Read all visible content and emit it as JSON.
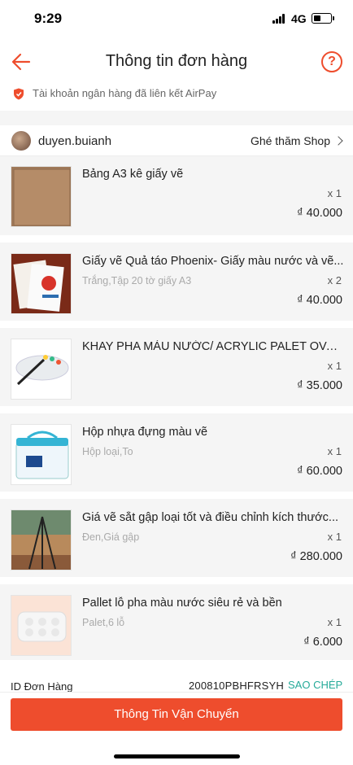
{
  "status": {
    "time": "9:29",
    "network": "4G"
  },
  "header": {
    "title": "Thông tin đơn hàng",
    "help": "?"
  },
  "airpay": {
    "text": "Tài khoản ngân hàng đã liên kết AirPay"
  },
  "shop": {
    "name": "duyen.buianh",
    "visit_label": "Ghé thăm Shop"
  },
  "products": [
    {
      "name": "Bảng A3 kê giấy vẽ",
      "variant": "",
      "qty": "x 1",
      "price": "₫ 40.000"
    },
    {
      "name": "Giấy vẽ Quả táo Phoenix- Giấy màu nước và vẽ...",
      "variant": "Trắng,Tập 20 tờ giấy A3",
      "qty": "x 2",
      "price": "₫ 40.000"
    },
    {
      "name": "KHAY PHA MÀU NƯỚC/ ACRYLIC PALET OVAL...",
      "variant": "",
      "qty": "x 1",
      "price": "₫ 35.000"
    },
    {
      "name": "Hộp nhựa đựng màu vẽ",
      "variant": "Hộp loại,To",
      "qty": "x 1",
      "price": "₫ 60.000"
    },
    {
      "name": "Giá vẽ sắt gập loại tốt và điều chỉnh kích thước...",
      "variant": "Đen,Giá gập",
      "qty": "x 1",
      "price": "₫ 280.000"
    },
    {
      "name": "Pallet lỗ pha màu nước siêu rẻ và bền",
      "variant": "Palet,6 lỗ",
      "qty": "x 1",
      "price": "₫ 6.000"
    }
  ],
  "order": {
    "id_label": "ID Đơn Hàng",
    "id_value": "200810PBHFRSYH",
    "copy_label": "SAO CHÉP"
  },
  "actions": {
    "shipping_label": "Thông Tin Vận Chuyển"
  },
  "colors": {
    "accent": "#ee4d2d",
    "link": "#26aa99"
  },
  "icons": [
    "back-arrow-icon",
    "help-icon",
    "shield-icon",
    "chevron-right-icon"
  ]
}
